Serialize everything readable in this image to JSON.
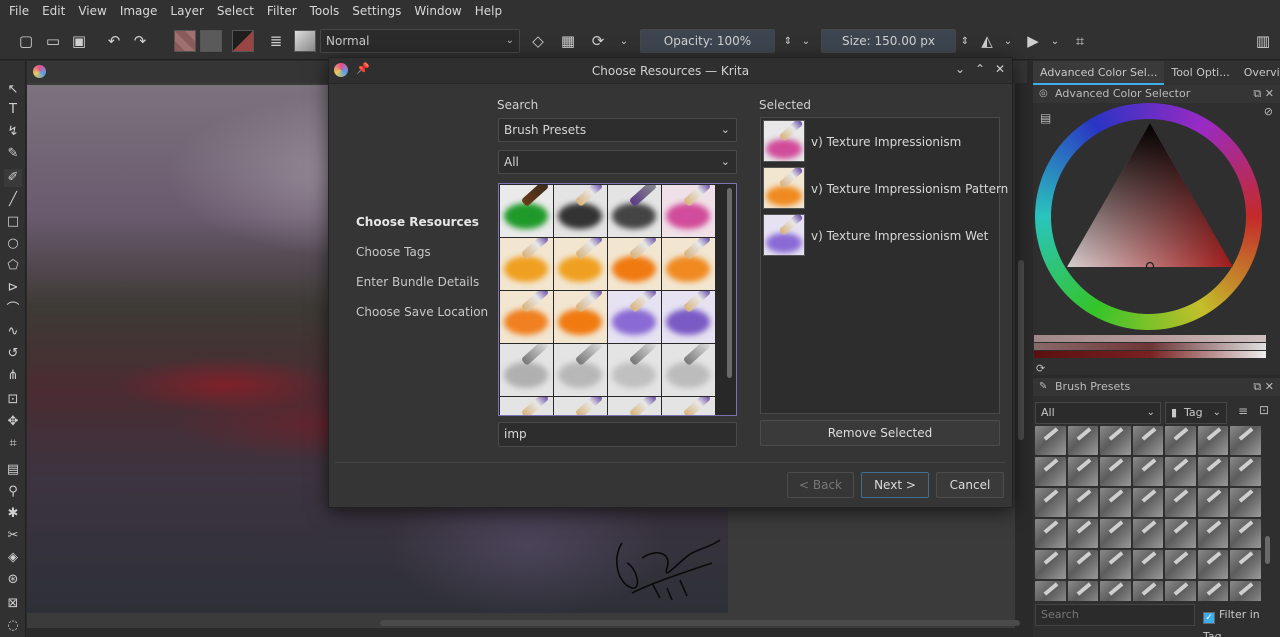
{
  "menu": [
    "File",
    "Edit",
    "View",
    "Image",
    "Layer",
    "Select",
    "Filter",
    "Tools",
    "Settings",
    "Window",
    "Help"
  ],
  "toolbar": {
    "blend_mode": "Normal",
    "opacity": "Opacity: 100%",
    "size": "Size: 150.00 px"
  },
  "dock": {
    "tabs": [
      "Advanced Color Sel...",
      "Tool Opti...",
      "Overview"
    ],
    "color_selector_title": "Advanced Color Selector",
    "brush_presets_title": "Brush Presets",
    "bp_filter_all": "All",
    "bp_tag": "Tag",
    "bp_search_placeholder": "Search",
    "bp_filter_in_tag": "Filter in Tag"
  },
  "dialog": {
    "title": "Choose Resources — Krita",
    "steps": [
      "Choose Resources",
      "Choose Tags",
      "Enter Bundle Details",
      "Choose Save Location"
    ],
    "search_label": "Search",
    "resource_type": "Brush Presets",
    "tag_filter": "All",
    "filter_text": "imp",
    "selected_label": "Selected",
    "selected_items": [
      "v) Texture Impressionism",
      "v) Texture Impressionism Pattern",
      "v) Texture Impressionism Wet"
    ],
    "remove_selected": "Remove Selected",
    "back": "< Back",
    "next": "Next >",
    "cancel": "Cancel"
  },
  "colors": {
    "accent": "#3daee9",
    "grid_border": "#7a73b5"
  }
}
